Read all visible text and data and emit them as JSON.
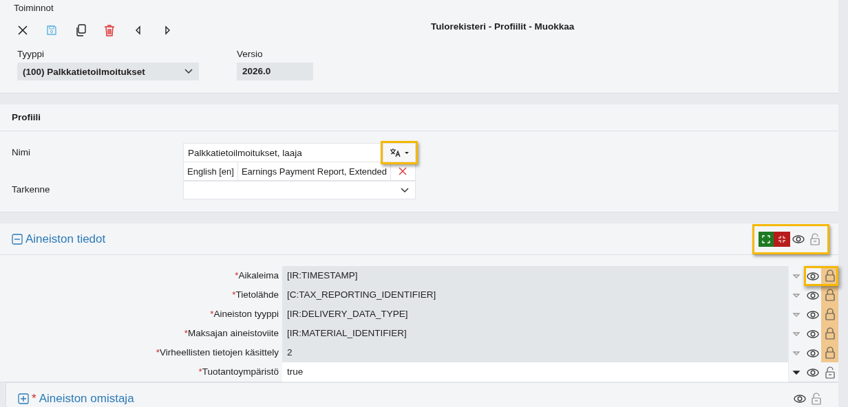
{
  "toolbar": {
    "title": "Toiminnot",
    "actions": [
      {
        "kind": "close"
      },
      {
        "kind": "save"
      },
      {
        "kind": "copy"
      },
      {
        "kind": "delete"
      },
      {
        "kind": "previous"
      },
      {
        "kind": "next"
      }
    ]
  },
  "page_title": "Tulorekisteri - Profiilit - Muokkaa",
  "type_field": {
    "label": "Tyyppi",
    "value": "(100) Palkkatietoilmoitukset"
  },
  "version_field": {
    "label": "Versio",
    "value": "2026.0"
  },
  "profile": {
    "title": "Profiili",
    "name": {
      "label": "Nimi",
      "value": "Palkkatietoilmoitukset, laaja",
      "translate_highlighted": true,
      "translations": [
        {
          "language": "English [en]",
          "value": "Earnings Payment Report, Extended"
        }
      ]
    },
    "specifier": {
      "label": "Tarkenne"
    }
  },
  "sections": [
    {
      "title": "Aineiston tiedot",
      "expanded": true,
      "toolbar_highlighted": true,
      "rows": [
        {
          "required_mark": "*",
          "label": "Aikaleima",
          "value": "[IR:TIMESTAMP]",
          "locked": true,
          "highlighted": true
        },
        {
          "required_mark": "*",
          "label": "Tietolähde",
          "value": "[C:TAX_REPORTING_IDENTIFIER]",
          "locked": true,
          "highlighted": false
        },
        {
          "required_mark": "*",
          "label": "Aineiston tyyppi",
          "value": "[IR:DELIVERY_DATA_TYPE]",
          "locked": true,
          "highlighted": false
        },
        {
          "required_mark": "*",
          "label": "Maksajan aineistoviite",
          "value": "[IR:MATERIAL_IDENTIFIER]",
          "locked": true,
          "highlighted": false
        },
        {
          "required_mark": "*",
          "label": "Virheellisten tietojen käsittely",
          "value": "2",
          "locked": true,
          "highlighted": false
        },
        {
          "required_mark": "*",
          "label": "Tuotantoympäristö",
          "value": "true",
          "locked": false,
          "highlighted": false
        }
      ]
    },
    {
      "required_mark": "*",
      "title": "Aineiston omistaja",
      "expanded": false,
      "toolbar_highlighted": false
    }
  ]
}
